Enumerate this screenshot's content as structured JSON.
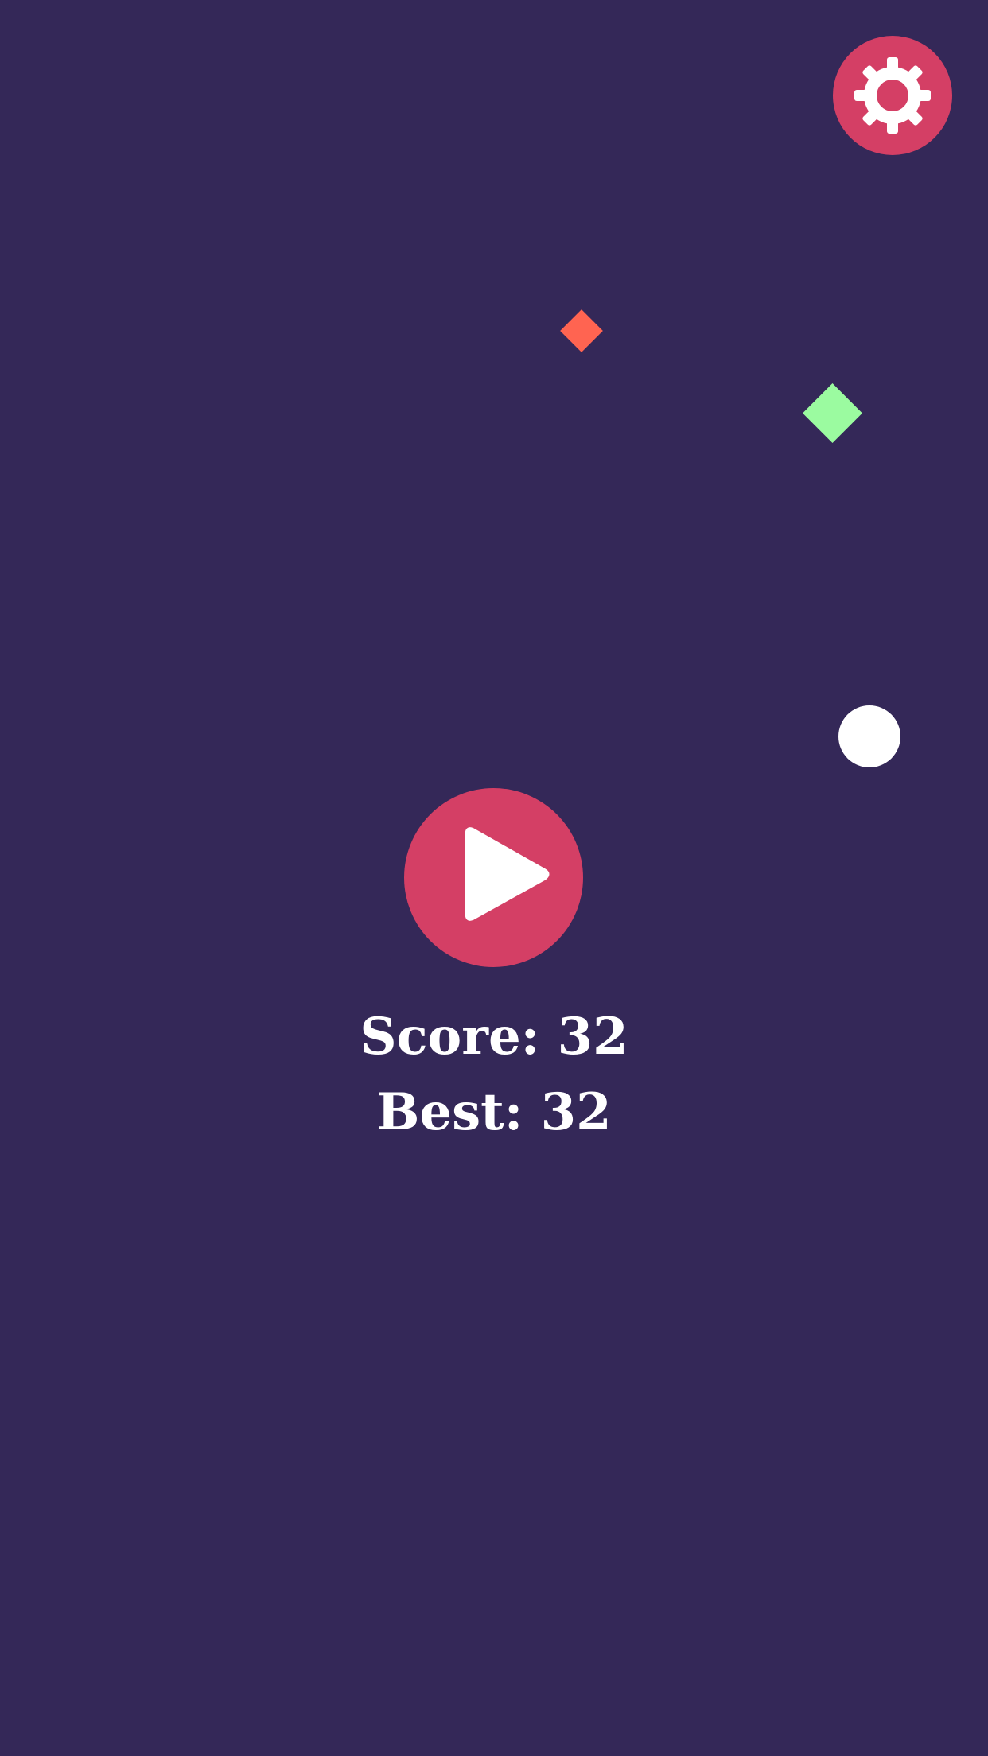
{
  "colors": {
    "background": "#342858",
    "accent": "#d43f65",
    "diamond_orange": "#ff6451",
    "diamond_green": "#9bfba0",
    "ball": "#ffffff"
  },
  "settings": {
    "icon": "gear-icon"
  },
  "play": {
    "icon": "play-icon"
  },
  "score": {
    "label": "Score:",
    "value": "32"
  },
  "best": {
    "label": "Best:",
    "value": "32"
  }
}
